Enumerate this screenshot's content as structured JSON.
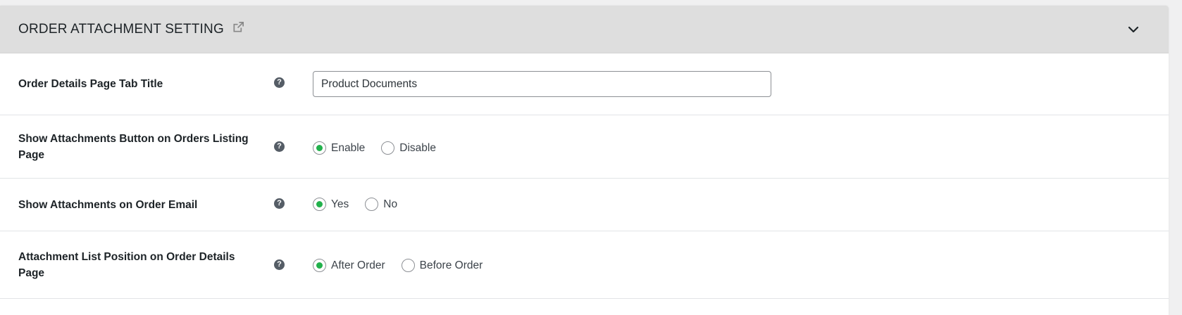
{
  "header": {
    "title": "ORDER ATTACHMENT SETTING"
  },
  "colors": {
    "header_bg": "#dedede",
    "radio_checked": "#22b14c",
    "help_icon": "#555d66"
  },
  "rows": [
    {
      "label": "Order Details Page Tab Title",
      "help": "?",
      "input_value": "Product Documents"
    },
    {
      "label": "Show Attachments Button on Orders Listing Page",
      "help": "?",
      "options": [
        "Enable",
        "Disable"
      ],
      "selected": "Enable"
    },
    {
      "label": "Show Attachments on Order Email",
      "help": "?",
      "options": [
        "Yes",
        "No"
      ],
      "selected": "Yes"
    },
    {
      "label": "Attachment List Position on Order Details Page",
      "help": "?",
      "options": [
        "After Order",
        "Before Order"
      ],
      "selected": "After Order"
    }
  ]
}
